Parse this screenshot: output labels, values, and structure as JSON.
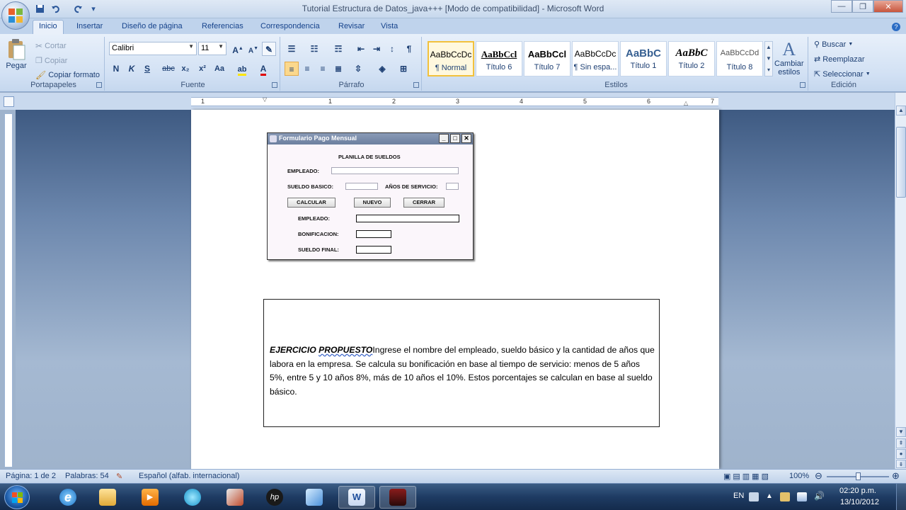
{
  "window": {
    "title": "Tutorial Estructura de Datos_java+++ [Modo de compatibilidad] - Microsoft Word"
  },
  "qat": {
    "save_icon": "save-icon",
    "undo_icon": "undo-icon",
    "redo_icon": "redo-icon"
  },
  "tabs": [
    "Inicio",
    "Insertar",
    "Diseño de página",
    "Referencias",
    "Correspondencia",
    "Revisar",
    "Vista"
  ],
  "ribbon": {
    "clipboard": {
      "label": "Portapapeles",
      "paste": "Pegar",
      "cut": "Cortar",
      "copy": "Copiar",
      "format_painter": "Copiar formato"
    },
    "font": {
      "label": "Fuente",
      "family": "Calibri",
      "size": "11",
      "bold": "N",
      "italic": "K",
      "underline": "S",
      "strike": "abc",
      "subscript": "x₂",
      "superscript": "x²",
      "change_case": "Aa"
    },
    "paragraph": {
      "label": "Párrafo"
    },
    "styles": {
      "label": "Estilos",
      "items": [
        {
          "sample": "AaBbCcDc",
          "name": "¶ Normal"
        },
        {
          "sample": "AaBbCcl",
          "name": "Título 6"
        },
        {
          "sample": "AaBbCcl",
          "name": "Título 7"
        },
        {
          "sample": "AaBbCcDc",
          "name": "¶ Sin espa..."
        },
        {
          "sample": "AaBbC",
          "name": "Título 1"
        },
        {
          "sample": "AaBbC",
          "name": "Título 2"
        },
        {
          "sample": "AaBbCcDd",
          "name": "Título 8"
        }
      ],
      "change_styles_line1": "Cambiar",
      "change_styles_line2": "estilos"
    },
    "editing": {
      "label": "Edición",
      "find": "Buscar",
      "replace": "Reemplazar",
      "select": "Seleccionar"
    }
  },
  "ruler": {
    "numbers": [
      "1",
      "1",
      "2",
      "3",
      "4",
      "5",
      "6",
      "7"
    ]
  },
  "form_image": {
    "window_title": "Formulario Pago Mensual",
    "heading": "PLANILLA DE SUELDOS",
    "employee_label": "EMPLEADO:",
    "basic_salary_label": "SUELDO BASICO:",
    "years_label": "AÑOS DE SERVICIO:",
    "calc_button": "CALCULAR",
    "new_button": "NUEVO",
    "close_button": "CERRAR",
    "out_employee_label": "EMPLEADO:",
    "bonus_label": "BONIFICACION:",
    "final_salary_label": "SUELDO FINAL:"
  },
  "textbox": {
    "lead_part1": "EJERCICIO ",
    "lead_part2": "PROPUESTO",
    "body": "Ingrese el nombre del empleado, sueldo básico y la cantidad de años que labora en la empresa. Se calcula su bonificación en base al tiempo de servicio: menos de 5 años 5%, entre 5 y 10 años 8%, más de 10 años el 10%. Estos porcentajes se calculan en base al sueldo básico."
  },
  "statusbar": {
    "page": "Página: 1 de 2",
    "words": "Palabras: 54",
    "language": "Español (alfab. internacional)",
    "zoom": "100%"
  },
  "taskbar": {
    "language": "EN",
    "time": "02:20 p.m.",
    "date": "13/10/2012"
  },
  "colors": {
    "ribbon_bg": "#d2e1f4",
    "accent": "#15428b",
    "taskbar": "#1e3b63"
  }
}
